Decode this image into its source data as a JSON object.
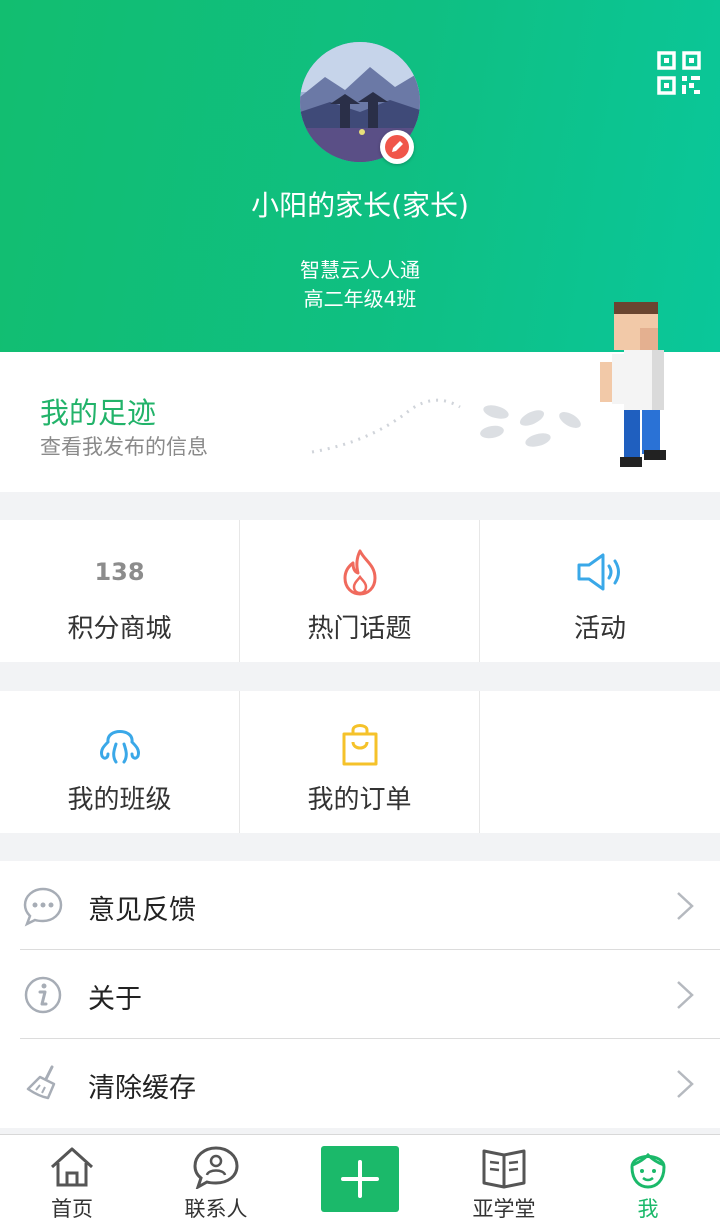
{
  "header": {
    "user_name": "小阳的家长(家长)",
    "school": "智慧云人人通",
    "class_name": "高二年级4班",
    "icons": {
      "qr": "qr-code-icon",
      "edit": "pencil-icon"
    }
  },
  "footprint": {
    "title": "我的足迹",
    "subtitle": "查看我发布的信息"
  },
  "grid": {
    "points_value": "138",
    "points_label": "积分商城",
    "hot_topics_label": "热门话题",
    "activity_label": "活动",
    "my_class_label": "我的班级",
    "my_orders_label": "我的订单"
  },
  "list": [
    {
      "label": "意见反馈",
      "icon": "chat-bubble-icon"
    },
    {
      "label": "关于",
      "icon": "info-icon"
    },
    {
      "label": "清除缓存",
      "icon": "broom-icon"
    }
  ],
  "tabbar": {
    "home": "首页",
    "contacts": "联系人",
    "academy": "亚学堂",
    "me": "我",
    "active": "我"
  },
  "colors": {
    "accent_green": "#1bb96a",
    "fire_red": "#f06a5d",
    "sound_blue": "#3aa8e8",
    "bag_yellow": "#f5c22a"
  }
}
